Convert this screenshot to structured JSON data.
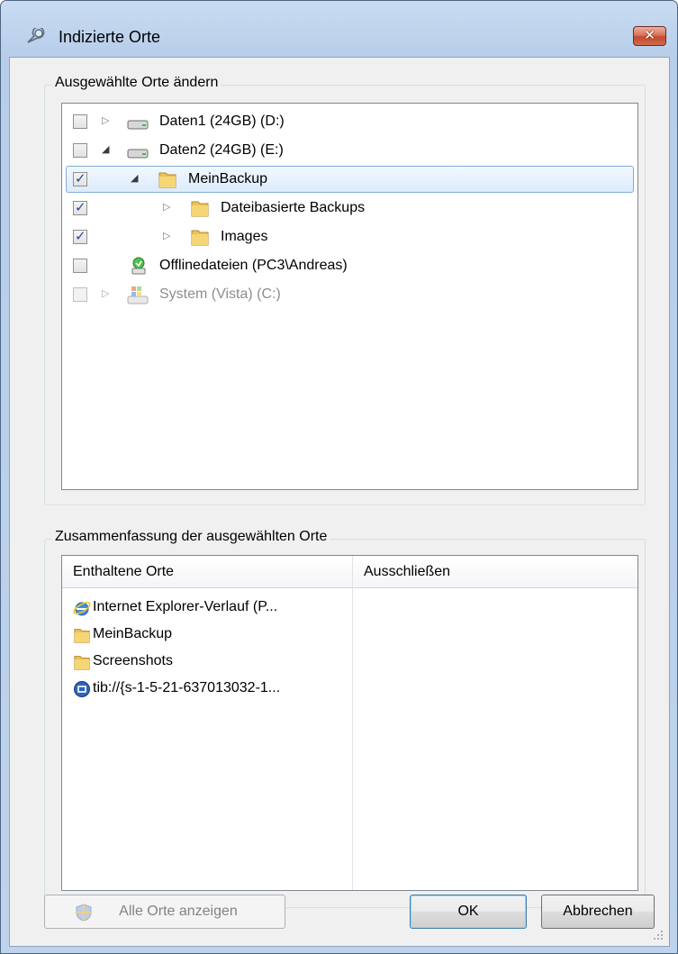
{
  "window": {
    "title": "Indizierte Orte",
    "close_label": "✕"
  },
  "selected_group": {
    "label": "Ausgewählte Orte ändern",
    "items": [
      {
        "label": "Daten1 (24GB) (D:)",
        "checked": false,
        "expander": "collapsed",
        "icon": "drive-icon",
        "disabled": false
      },
      {
        "label": "Daten2 (24GB) (E:)",
        "checked": false,
        "expander": "expanded",
        "icon": "drive-icon",
        "disabled": false
      },
      {
        "label": "MeinBackup",
        "checked": true,
        "expander": "expanded",
        "icon": "folder-icon",
        "selected": true,
        "disabled": false
      },
      {
        "label": "Dateibasierte Backups",
        "checked": true,
        "expander": "collapsed",
        "icon": "folder-icon",
        "disabled": false
      },
      {
        "label": "Images",
        "checked": true,
        "expander": "collapsed",
        "icon": "folder-icon",
        "disabled": false
      },
      {
        "label": "Offlinedateien (PC3\\Andreas)",
        "checked": false,
        "expander": "none",
        "icon": "offline-files-icon",
        "disabled": false
      },
      {
        "label": "System (Vista) (C:)",
        "checked": false,
        "expander": "collapsed",
        "icon": "system-drive-icon",
        "disabled": true
      }
    ]
  },
  "summary_group": {
    "label": "Zusammenfassung der ausgewählten Orte",
    "columns": [
      "Enthaltene Orte",
      "Ausschließen"
    ],
    "included": [
      {
        "label": "Internet Explorer-Verlauf (P...",
        "icon": "internet-explorer-icon"
      },
      {
        "label": "MeinBackup",
        "icon": "folder-icon"
      },
      {
        "label": "Screenshots",
        "icon": "folder-icon"
      },
      {
        "label": "tib://{s-1-5-21-637013032-1...",
        "icon": "backup-archive-icon"
      }
    ]
  },
  "buttons": {
    "show_all": "Alle Orte anzeigen",
    "ok": "OK",
    "cancel": "Abbrechen"
  },
  "colors": {
    "selection_border": "#84acdd",
    "selection_fill": "#dcebfc",
    "close_button": "#c44a2c"
  }
}
